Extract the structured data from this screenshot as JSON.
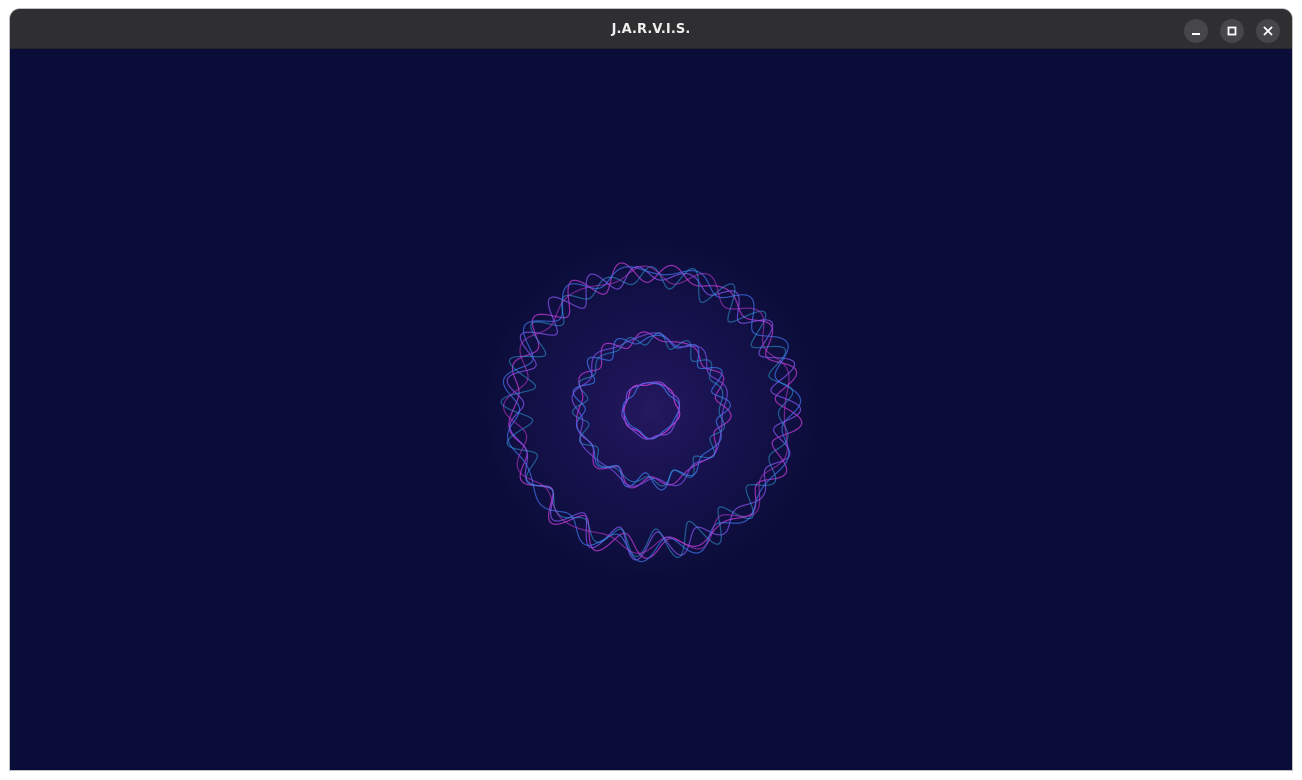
{
  "window": {
    "title": "J.A.R.V.I.S.",
    "background_color": "#0a0d38",
    "titlebar_color": "#2f2e31",
    "controls": {
      "minimize_icon": "minimize-icon",
      "maximize_icon": "maximize-icon",
      "close_icon": "close-icon"
    }
  },
  "visualizer": {
    "icon": "audio-waveform-rings",
    "colors": {
      "magenta": "#c23bd4",
      "violet": "#7a4fe0",
      "blue": "#3b6fe0",
      "cyan": "#2f9fd8",
      "glow": "#3a1f7a"
    }
  }
}
